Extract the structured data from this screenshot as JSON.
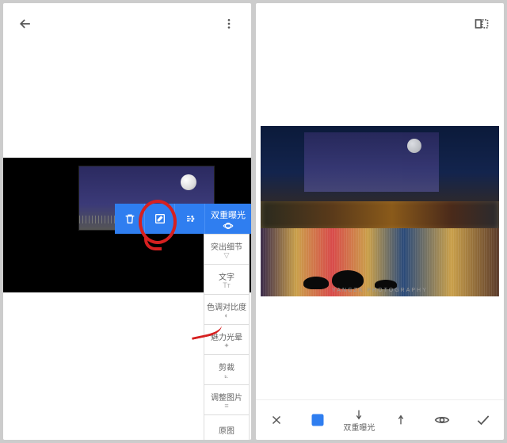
{
  "left": {
    "toolbar_head": "双重曝光",
    "menu": [
      {
        "label": "突出细节"
      },
      {
        "label": "文字"
      },
      {
        "label": "色调对比度"
      },
      {
        "label": "魅力光晕"
      },
      {
        "label": "剪裁"
      },
      {
        "label": "调整图片"
      },
      {
        "label": "原图"
      }
    ]
  },
  "right": {
    "watermark": "YANGZK PHOTOGRAPHY",
    "bottom_label": "双重曝光"
  }
}
